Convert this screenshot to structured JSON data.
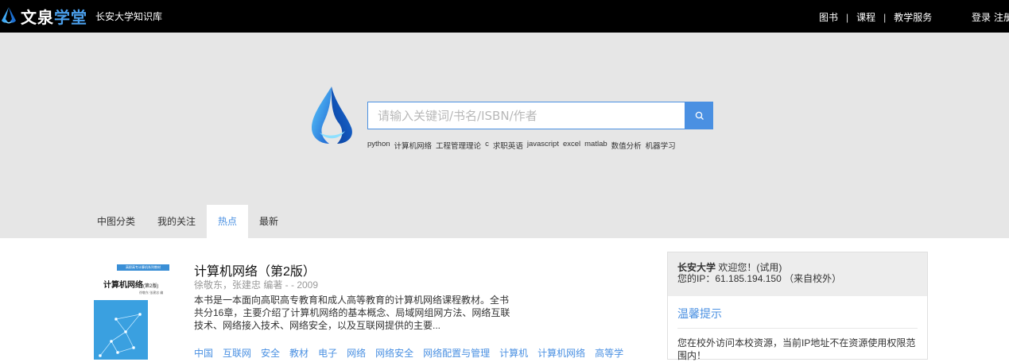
{
  "header": {
    "brand_part1": "文泉",
    "brand_part2": "学堂",
    "school": "长安大学知识库",
    "nav": [
      "图书",
      "课程",
      "教学服务"
    ],
    "login": "登录",
    "register": "注册"
  },
  "search": {
    "placeholder": "请输入关键词/书名/ISBN/作者",
    "hot_keywords": [
      "python",
      "计算机网络",
      "工程管理理论",
      "c",
      "求职英语",
      "javascript",
      "excel",
      "matlab",
      "数值分析",
      "机器学习"
    ]
  },
  "tabs": [
    "中图分类",
    "我的关注",
    "热点",
    "最新"
  ],
  "active_tab": "热点",
  "book": {
    "cover_band": "高职高专计算机系列教材",
    "cover_title": "计算机网络",
    "cover_edition": "(第2版)",
    "cover_authors": "徐敬东  张建忠  编",
    "title": "计算机网络（第2版）",
    "meta": "徐敬东，张建忠 编著 - - 2009",
    "description": "本书是一本面向高职高专教育和成人高等教育的计算机网络课程教材。全书共分16章，主要介绍了计算机网络的基本概念、局域网组网方法、网络互联技术、网络接入技术、网络安全，以及互联网提供的主要...",
    "tags": [
      "中国",
      "互联网",
      "安全",
      "教材",
      "电子",
      "网络",
      "网络安全",
      "网络配置与管理",
      "计算机",
      "计算机网络",
      "高等学"
    ]
  },
  "panel": {
    "school": "长安大学",
    "welcome": " 欢迎您！(试用)",
    "ip_line": "您的IP：61.185.194.150 （来自校外）",
    "tip_title": "温馨提示",
    "tip_text": "您在校外访问本校资源，当前IP地址不在资源使用权限范围内！"
  },
  "colors": {
    "accent": "#4a90e2",
    "topbar": "#000000",
    "hero_bg": "#e6e6e6"
  }
}
